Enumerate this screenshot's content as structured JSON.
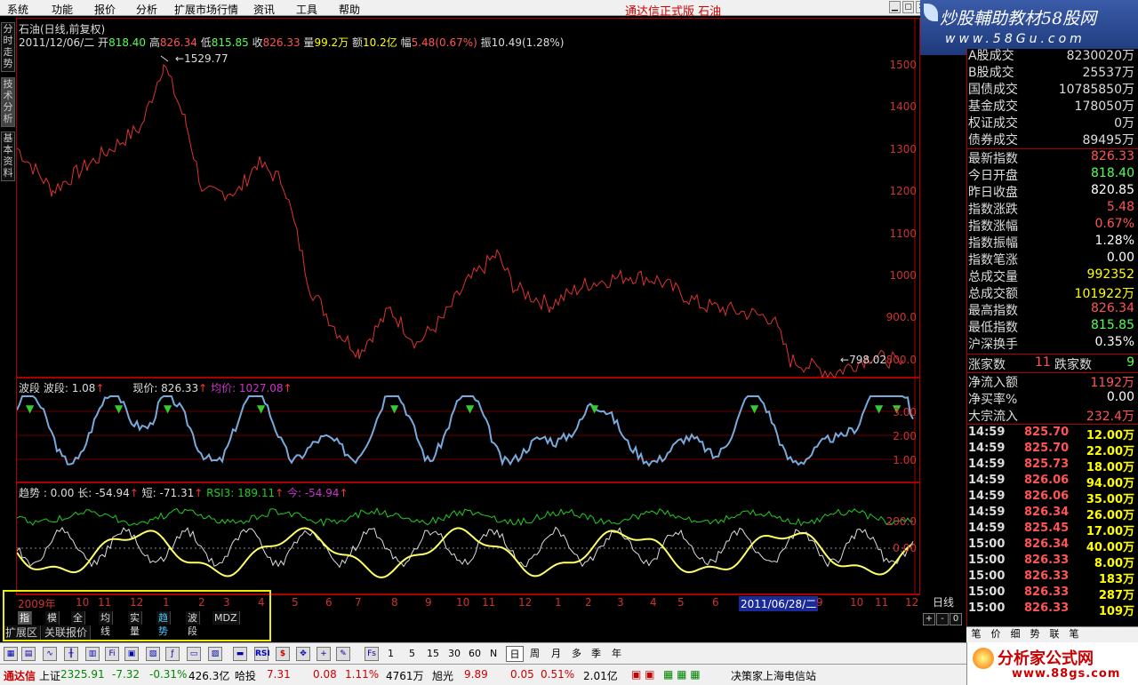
{
  "menu": {
    "items": [
      "系统",
      "功能",
      "报价",
      "分析",
      "扩展市场行情",
      "资讯",
      "工具",
      "帮助"
    ],
    "app_title": "通达信正式版 石油"
  },
  "brand": {
    "title": "炒股輔助教材58股网",
    "url": "www.58Gu.com"
  },
  "left_tabs": [
    "分时走势",
    "技术分析",
    "基本资料"
  ],
  "chart": {
    "stock_title": "石油(日线,前复权)",
    "date": "2011/12/06/二",
    "open_label": "开",
    "open": "818.40",
    "high_label": "高",
    "high": "826.34",
    "low_label": "低",
    "low": "815.85",
    "close_label": "收",
    "close": "826.33",
    "vol_label": "量",
    "vol": "99.2万",
    "amt_label": "额",
    "amt": "10.2亿",
    "chg_label": "幅",
    "chg": "5.48(0.67%)",
    "amp_label": "振",
    "amp": "10.49(1.28%)",
    "hi_marker": "1529.77",
    "lo_marker": "798.02",
    "y_labels": [
      "1500",
      "1400",
      "1300",
      "1200",
      "1100",
      "1000",
      "900.0",
      "800.0"
    ]
  },
  "wave_ind": {
    "label1": "波段",
    "label2": "波段: 1.08",
    "label3": "现价: 826.33",
    "label4": "均价: 1027.08",
    "y_labels": [
      "3.00",
      "2.00",
      "1.00"
    ]
  },
  "trend_ind": {
    "label1": "趋势 : 0.00",
    "label2": "长: -54.94",
    "label3": "短: -71.31",
    "label4": "RSI3: 189.11",
    "label5": "今: -54.94",
    "y_labels": [
      "200.0",
      "0.00"
    ]
  },
  "time_axis": {
    "ticks": [
      "2009年",
      "10",
      "11",
      "12",
      "1",
      "2",
      "3",
      "4",
      "5",
      "6",
      "7",
      "8",
      "9",
      "10",
      "11",
      "12",
      "1",
      "2",
      "3",
      "4",
      "5",
      "6",
      "2011/06/28/二",
      "9",
      "10",
      "11",
      "12"
    ],
    "unit": "日线"
  },
  "zoom": [
    "+",
    "-",
    "0"
  ],
  "ind_tabs": [
    "指标",
    "模板",
    "全部",
    "均线",
    "实量",
    "趋势",
    "波段",
    "MDZ"
  ],
  "ext_tabs": [
    "扩展区",
    "关联报价"
  ],
  "quote": {
    "top_rows": [
      {
        "k": "A股成交",
        "v": "8230020万"
      },
      {
        "k": "B股成交",
        "v": "25537万"
      },
      {
        "k": "国债成交",
        "v": "10785850万"
      },
      {
        "k": "基金成交",
        "v": "178050万"
      },
      {
        "k": "权证成交",
        "v": "0万"
      },
      {
        "k": "债券成交",
        "v": "89495万"
      }
    ],
    "index_rows": [
      {
        "k": "最新指数",
        "v": "826.33",
        "c": "#f55"
      },
      {
        "k": "今日开盘",
        "v": "818.40",
        "c": "#5f5"
      },
      {
        "k": "昨日收盘",
        "v": "820.85",
        "c": "#fff"
      },
      {
        "k": "指数涨跌",
        "v": "5.48",
        "c": "#f55"
      },
      {
        "k": "指数涨幅",
        "v": "0.67%",
        "c": "#f55"
      },
      {
        "k": "指数振幅",
        "v": "1.28%",
        "c": "#fff"
      },
      {
        "k": "指数笔涨",
        "v": "0.00",
        "c": "#fff"
      },
      {
        "k": "总成交量",
        "v": "992352",
        "c": "#ff0"
      },
      {
        "k": "总成交额",
        "v": "101922万",
        "c": "#ff0"
      },
      {
        "k": "最高指数",
        "v": "826.34",
        "c": "#f55"
      },
      {
        "k": "最低指数",
        "v": "815.85",
        "c": "#5f5"
      },
      {
        "k": "沪深换手",
        "v": "0.35%",
        "c": "#fff"
      }
    ],
    "up_label": "涨家数",
    "up_count": "11",
    "down_label": "跌家数",
    "down_count": "9",
    "flow_rows": [
      {
        "k": "净流入额",
        "v": "1192万",
        "c": "#f55"
      },
      {
        "k": "净买率%",
        "v": "0.00",
        "c": "#fff"
      },
      {
        "k": "大宗流入",
        "v": "232.4万",
        "c": "#f55"
      }
    ],
    "ticks": [
      {
        "t": "14:59",
        "p": "825.70",
        "v": "12.00万"
      },
      {
        "t": "14:59",
        "p": "825.70",
        "v": "22.00万"
      },
      {
        "t": "14:59",
        "p": "825.73",
        "v": "18.00万"
      },
      {
        "t": "14:59",
        "p": "826.06",
        "v": "94.00万"
      },
      {
        "t": "14:59",
        "p": "826.06",
        "v": "35.00万"
      },
      {
        "t": "14:59",
        "p": "826.34",
        "v": "26.00万"
      },
      {
        "t": "14:59",
        "p": "825.45",
        "v": "17.00万"
      },
      {
        "t": "15:00",
        "p": "826.34",
        "v": "40.00万"
      },
      {
        "t": "15:00",
        "p": "826.33",
        "v": "8.00万"
      },
      {
        "t": "15:00",
        "p": "826.33",
        "v": "183万"
      },
      {
        "t": "15:00",
        "p": "826.33",
        "v": "287万"
      },
      {
        "t": "15:00",
        "p": "826.33",
        "v": "109万"
      }
    ]
  },
  "rp_tabs": [
    "笔",
    "价",
    "细",
    "势",
    "联",
    "笔"
  ],
  "toolbar": {
    "periods": [
      "1",
      "5",
      "15",
      "30",
      "60",
      "N",
      "日",
      "周",
      "月",
      "多",
      "季",
      "年"
    ],
    "icons": [
      "Fi",
      "Fs",
      "RSI",
      "$"
    ]
  },
  "ad": {
    "title": "分析家公式网",
    "url": "www.88gs.com"
  },
  "status": {
    "app": "通达信",
    "idx1_name": "上证",
    "idx1_val": "2325.91",
    "idx1_chg": "-7.32",
    "idx1_pct": "-0.31%",
    "idx1_amt": "426.3亿",
    "s2_name": "哈投",
    "s2_val": "7.31",
    "s2_chg": "0.08",
    "s2_pct": "1.11%",
    "s2_amt": "4761万",
    "s3_name": "旭光",
    "s3_val": "9.89",
    "s3_chg": "0.05",
    "s3_pct": "0.51%",
    "s3_amt": "2.01亿",
    "msg": "决策家上海电信站"
  }
}
